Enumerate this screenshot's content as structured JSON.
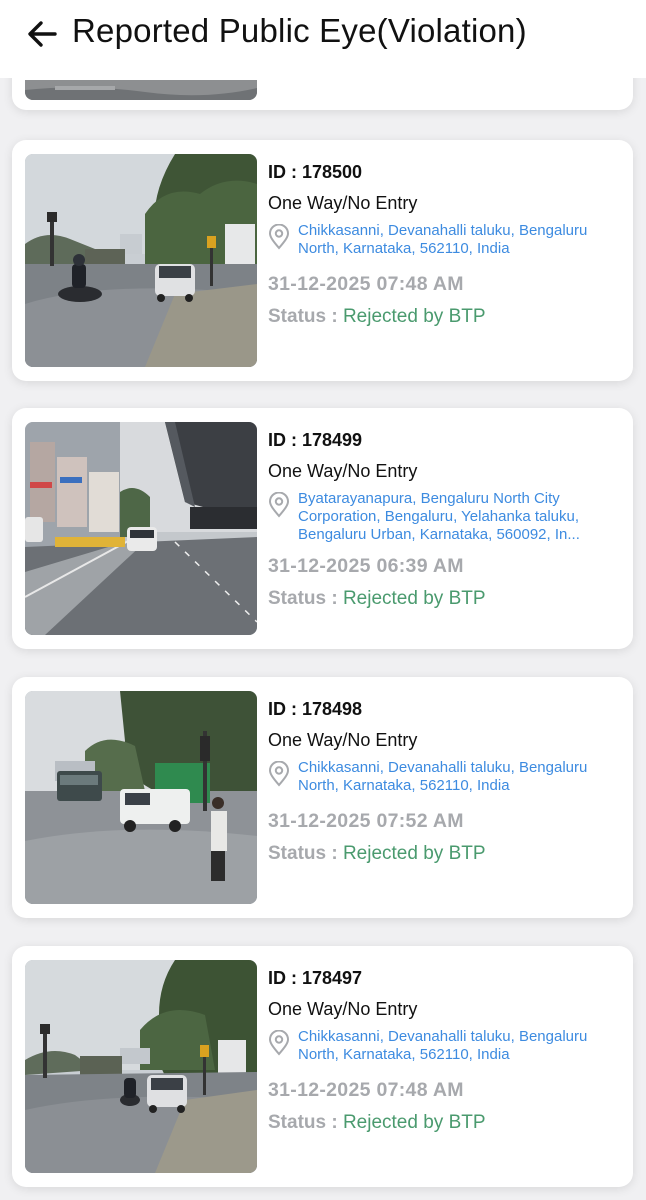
{
  "header": {
    "title": "Reported Public Eye(Violation)",
    "back_icon": "arrow-left-icon"
  },
  "colors": {
    "address": "#3d8be0",
    "status_value": "#4a9a6e",
    "muted": "#a7a9ad",
    "background": "#f0f0f2"
  },
  "reports": [
    {
      "id_label": "ID : ",
      "id": "178500",
      "type": "One Way/No Entry",
      "address": "Chikkasanni, Devanahalli taluku, Bengaluru North, Karnataka, 562110, India",
      "datetime": "31-12-2025 07:48 AM",
      "status_label": "Status : ",
      "status": "Rejected by BTP"
    },
    {
      "id_label": "ID : ",
      "id": "178499",
      "type": "One Way/No Entry",
      "address": "Byatarayanapura, Bengaluru North City Corporation, Bengaluru, Yelahanka taluku, Bengaluru Urban, Karnataka, 560092, In...",
      "datetime": "31-12-2025 06:39 AM",
      "status_label": "Status : ",
      "status": "Rejected by BTP"
    },
    {
      "id_label": "ID : ",
      "id": "178498",
      "type": "One Way/No Entry",
      "address": "Chikkasanni, Devanahalli taluku, Bengaluru North, Karnataka, 562110, India",
      "datetime": "31-12-2025 07:52 AM",
      "status_label": "Status : ",
      "status": "Rejected by BTP"
    },
    {
      "id_label": "ID : ",
      "id": "178497",
      "type": "One Way/No Entry",
      "address": "Chikkasanni, Devanahalli taluku, Bengaluru North, Karnataka, 562110, India",
      "datetime": "31-12-2025 07:48 AM",
      "status_label": "Status : ",
      "status": "Rejected by BTP"
    }
  ]
}
